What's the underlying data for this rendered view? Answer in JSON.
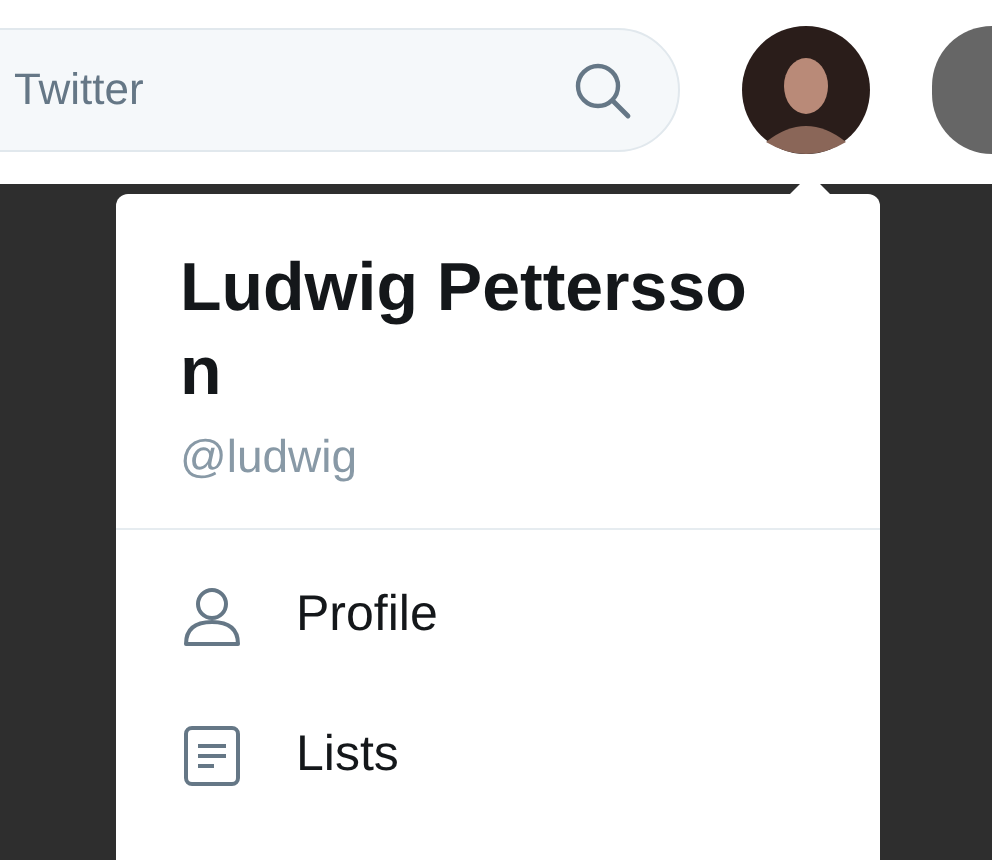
{
  "top_bar": {
    "search": {
      "placeholder": "Twitter"
    }
  },
  "account_menu": {
    "name": "Ludwig Pettersson",
    "handle": "@ludwig",
    "items": [
      {
        "kind": "profile",
        "label": "Profile"
      },
      {
        "kind": "lists",
        "label": "Lists"
      }
    ]
  }
}
